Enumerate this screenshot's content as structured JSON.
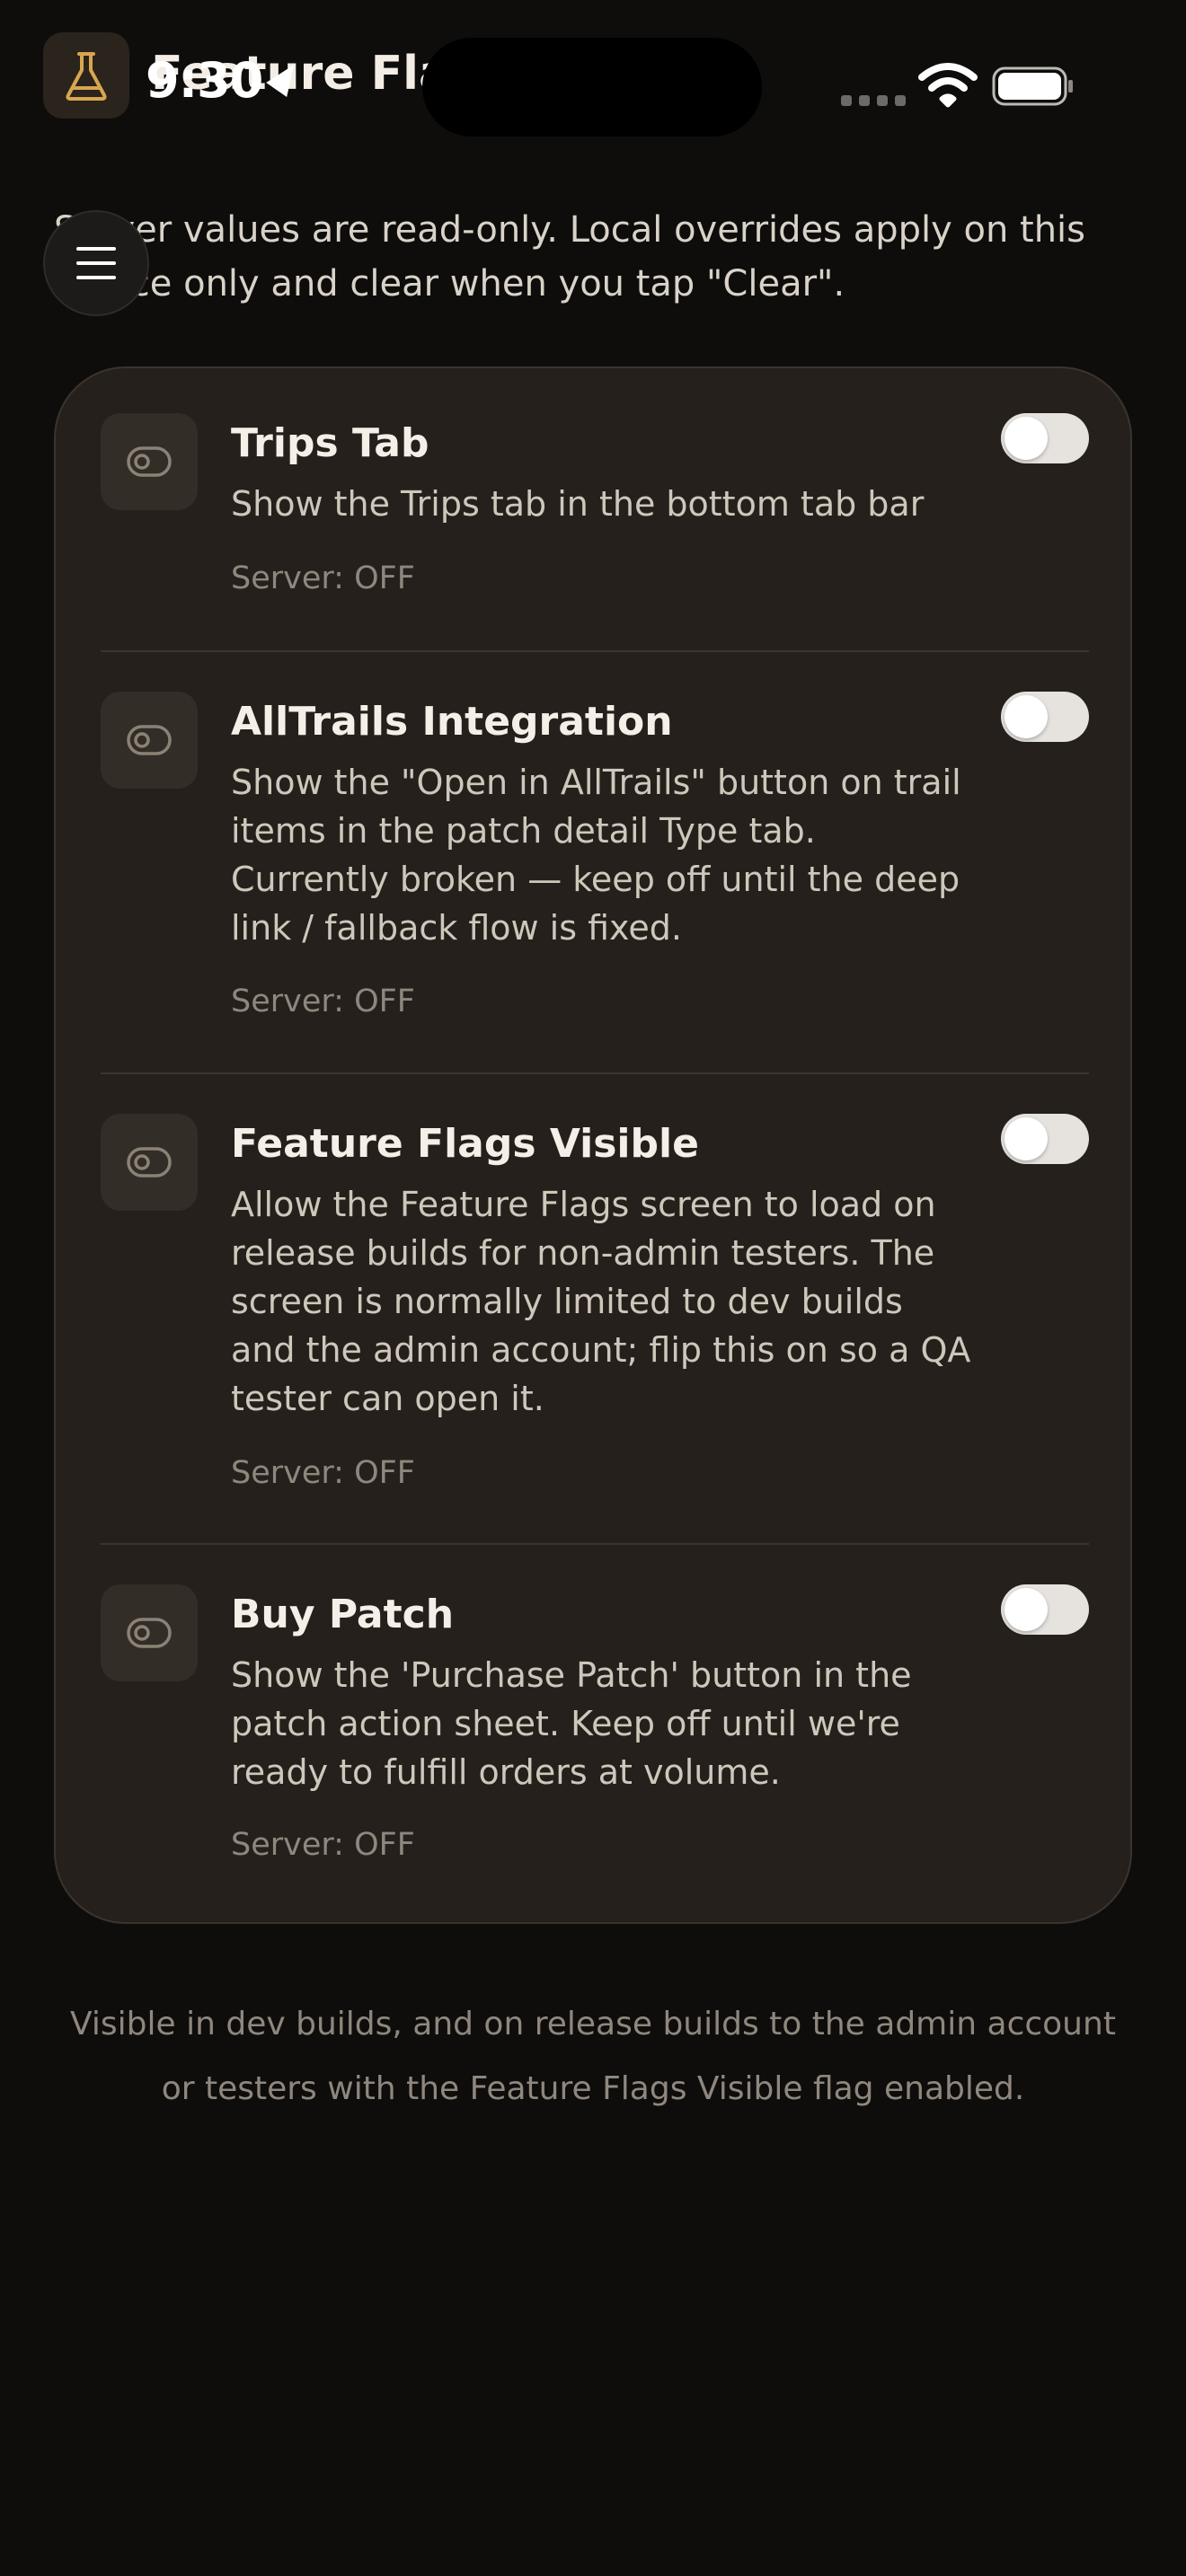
{
  "status_bar": {
    "time": "9:30",
    "location_icon": "location-arrow-icon",
    "wifi_icon": "wifi-icon",
    "battery_icon": "battery-icon",
    "signal_icon": "signal-dots-icon"
  },
  "header": {
    "app_icon": "flask-icon",
    "title": "Feature Flags",
    "menu_icon": "hamburger-menu-icon"
  },
  "intro": "Server values are read-only. Local overrides apply on this device only and clear when you tap \"Clear\".",
  "flags": [
    {
      "icon": "toggle-outline-icon",
      "title": "Trips Tab",
      "description": "Show the Trips tab in the bottom tab bar",
      "server": "Server: OFF",
      "enabled": false
    },
    {
      "icon": "toggle-outline-icon",
      "title": "AllTrails Integration",
      "description": "Show the \"Open in AllTrails\" button on trail items in the patch detail Type tab. Currently broken — keep off until the deep link / fallback flow is fixed.",
      "server": "Server: OFF",
      "enabled": false
    },
    {
      "icon": "toggle-outline-icon",
      "title": "Feature Flags Visible",
      "description": "Allow the Feature Flags screen to load on release builds for non-admin testers. The screen is normally limited to dev builds and the admin account; flip this on so a QA tester can open it.",
      "server": "Server: OFF",
      "enabled": false
    },
    {
      "icon": "toggle-outline-icon",
      "title": "Buy Patch",
      "description": "Show the 'Purchase Patch' button in the patch action sheet. Keep off until we're ready to fulfill orders at volume.",
      "server": "Server: OFF",
      "enabled": false
    }
  ],
  "footer": "Visible in dev builds, and on release builds to the admin account or testers with the Feature Flags Visible flag enabled.",
  "colors": {
    "background": "#0e0d0c",
    "card": "#25201b",
    "accent_gold": "#d9a650",
    "toggle_off": "#e6e3df"
  }
}
